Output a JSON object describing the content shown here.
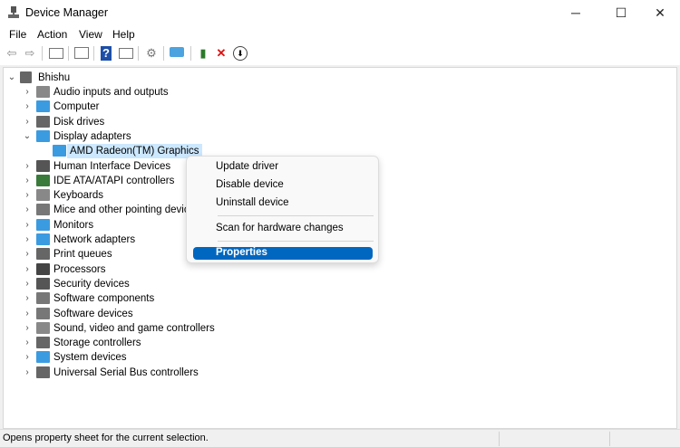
{
  "window": {
    "title": "Device Manager",
    "minimize": "─",
    "maximize": "☐",
    "close": "✕"
  },
  "menu": [
    "File",
    "Action",
    "View",
    "Help"
  ],
  "toolbar": {
    "icons": [
      "back-icon",
      "forward-icon",
      "show-hide-console-tree-icon",
      "properties-icon",
      "help-icon",
      "action-pane-icon",
      "update-driver-icon",
      "scan-hardware-icon",
      "enable-device-icon",
      "uninstall-icon",
      "disable-icon"
    ]
  },
  "tree": {
    "root": "Bhishu",
    "categories": [
      "Audio inputs and outputs",
      "Computer",
      "Disk drives",
      "Display adapters",
      "Human Interface Devices",
      "IDE ATA/ATAPI controllers",
      "Keyboards",
      "Mice and other pointing devic",
      "Monitors",
      "Network adapters",
      "Print queues",
      "Processors",
      "Security devices",
      "Software components",
      "Software devices",
      "Sound, video and game controllers",
      "Storage controllers",
      "System devices",
      "Universal Serial Bus controllers"
    ],
    "expanded": "Display adapters",
    "selected_child": "AMD Radeon(TM) Graphics"
  },
  "context_menu": {
    "items": [
      "Update driver",
      "Disable device",
      "Uninstall device",
      "Scan for hardware changes",
      "Properties"
    ],
    "highlighted": "Properties"
  },
  "status": {
    "text": "Opens property sheet for the current selection."
  },
  "colors": {
    "accent": "#0067c0",
    "selection": "#cce8ff"
  }
}
